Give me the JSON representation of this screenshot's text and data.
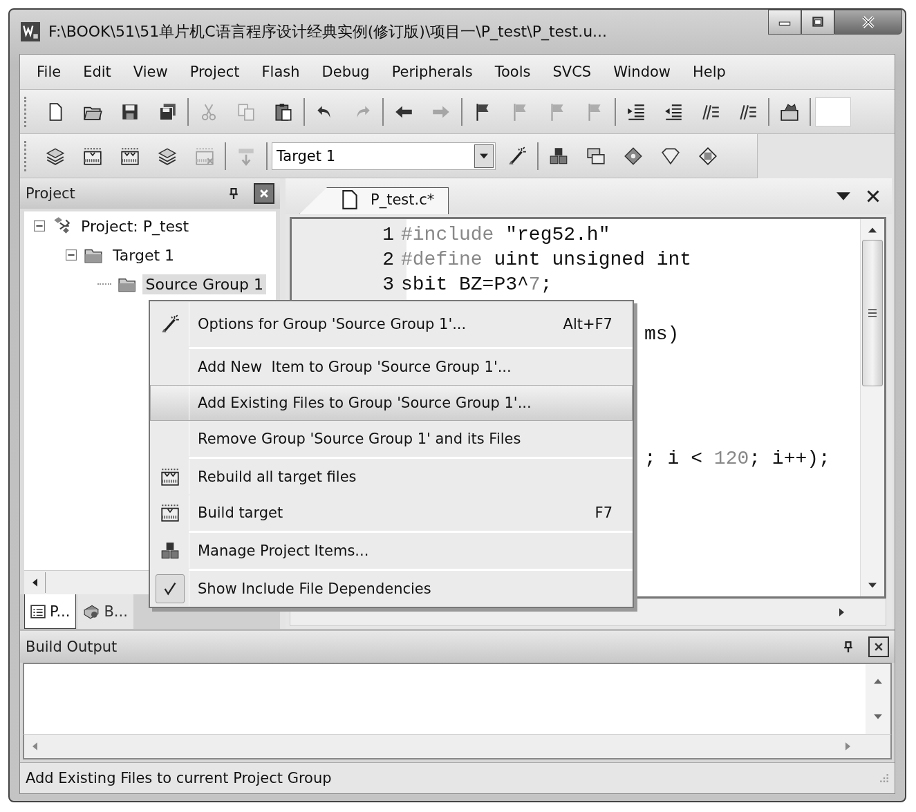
{
  "window": {
    "title": "F:\\BOOK\\51\\51单片机C语言程序设计经典实例(修订版)\\项目一\\P_test\\P_test.u..."
  },
  "menu_bar": [
    "File",
    "Edit",
    "View",
    "Project",
    "Flash",
    "Debug",
    "Peripherals",
    "Tools",
    "SVCS",
    "Window",
    "Help"
  ],
  "toolbar_1": {
    "groups": [
      [
        {
          "disabled": false
        },
        {
          "disabled": false
        },
        {
          "disabled": false
        },
        {
          "disabled": false
        }
      ],
      [
        {
          "disabled": true
        },
        {
          "disabled": true
        },
        {
          "disabled": false
        }
      ],
      [
        {
          "disabled": false
        },
        {
          "disabled": true
        }
      ],
      [
        {
          "disabled": false
        },
        {
          "disabled": true
        }
      ],
      [
        {
          "disabled": false
        },
        {
          "disabled": true
        },
        {
          "disabled": true
        },
        {
          "disabled": true
        }
      ],
      [
        {
          "disabled": false
        },
        {
          "disabled": false
        },
        {
          "disabled": false
        },
        {
          "disabled": false
        }
      ],
      [
        {
          "disabled": false
        }
      ]
    ]
  },
  "toolbar_2": {
    "groups": [
      [
        {
          "disabled": false
        },
        {
          "disabled": false
        },
        {
          "disabled": false
        },
        {
          "disabled": false
        },
        {
          "disabled": true
        }
      ],
      [
        {
          "disabled": true
        }
      ],
      [
        {
          "disabled": false
        }
      ],
      [
        {
          "disabled": false
        },
        {
          "disabled": false
        },
        {
          "disabled": false
        },
        {
          "disabled": false
        },
        {
          "disabled": false
        }
      ]
    ],
    "target_select": {
      "value": "Target 1"
    }
  },
  "project_panel": {
    "title": "Project",
    "tree": [
      {
        "label": "Project: P_test",
        "expanded": true,
        "selected": false,
        "children": [
          {
            "label": "Target 1",
            "expanded": true,
            "selected": false,
            "children": [
              {
                "label": "Source Group 1",
                "selected": true
              }
            ]
          }
        ]
      }
    ],
    "tabs": [
      {
        "label": "P...",
        "selected": true
      },
      {
        "label": "B...",
        "selected": false
      }
    ]
  },
  "editor": {
    "tabs": [
      {
        "label": "P_test.c*",
        "selected": true
      }
    ],
    "lines": [
      {
        "kind": "full",
        "number": "1",
        "tokens": [
          {
            "kind": "directive",
            "text": "#include"
          },
          {
            "kind": "plain",
            "text": " \"reg52.h\""
          }
        ]
      },
      {
        "kind": "full",
        "number": "2",
        "tokens": [
          {
            "kind": "directive",
            "text": "#define"
          },
          {
            "kind": "plain",
            "text": " uint unsigned int"
          }
        ]
      },
      {
        "kind": "full",
        "number": "3",
        "tokens": [
          {
            "kind": "plain",
            "text": "sbit BZ=P3^"
          },
          {
            "kind": "number",
            "text": "7"
          },
          {
            "kind": "plain",
            "text": ";"
          }
        ]
      },
      {
        "kind": "partial",
        "tokens": [
          {
            "kind": "plain",
            "text": "ms)"
          }
        ]
      },
      {
        "kind": "partial",
        "tokens": [
          {
            "kind": "plain",
            "text": "; i < "
          },
          {
            "kind": "number",
            "text": "120"
          },
          {
            "kind": "plain",
            "text": "; i++);"
          }
        ]
      }
    ]
  },
  "context_menu": {
    "groups": [
      {
        "items": [
          {
            "label": "Options for Group 'Source Group 1'...",
            "shortcut": "Alt+F7",
            "selected": false
          }
        ]
      },
      {
        "items": [
          {
            "label": "Add New  Item to Group 'Source Group 1'...",
            "selected": false
          },
          {
            "label": "Add Existing Files to Group 'Source Group 1'...",
            "selected": true
          },
          {
            "label": "Remove Group 'Source Group 1' and its Files",
            "selected": false
          }
        ]
      },
      {
        "items": [
          {
            "label": "Rebuild all target files",
            "selected": false
          },
          {
            "label": "Build target",
            "shortcut": "F7",
            "selected": false
          }
        ]
      },
      {
        "items": [
          {
            "label": "Manage Project Items...",
            "selected": false
          }
        ]
      },
      {
        "items": [
          {
            "label": "Show Include File Dependencies",
            "selected": false,
            "checked": true
          }
        ]
      }
    ]
  },
  "build_output": {
    "title": "Build Output"
  },
  "status_bar": {
    "text": "Add Existing Files to current Project Group"
  }
}
